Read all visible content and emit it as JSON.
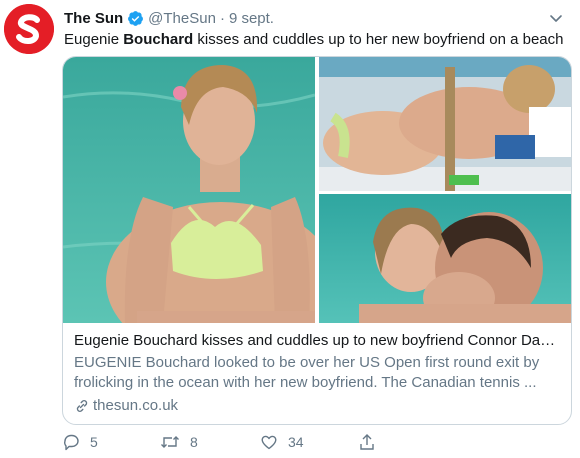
{
  "tweet": {
    "author_name": "The Sun",
    "handle": "@TheSun",
    "separator": "·",
    "timestamp": "9 sept.",
    "text_before": "Eugenie ",
    "text_bold": "Bouchard",
    "text_after": " kisses and cuddles up to her new boyfriend on a beach",
    "verified": true
  },
  "card": {
    "title": "Eugenie Bouchard kisses and cuddles up to new boyfriend Connor Davi...",
    "description_line1": "EUGENIE Bouchard looked to be over her US Open first round exit by",
    "description_line2": "frolicking in the ocean with her new boyfriend. The Canadian tennis ...",
    "domain": "thesun.co.uk"
  },
  "actions": {
    "replies": "5",
    "retweets": "8",
    "likes": "34"
  },
  "colors": {
    "brand_red": "#e41e26",
    "verified_blue": "#1da1f2",
    "muted_text": "#657786",
    "border": "#ccd6dd",
    "sea": "#4fb8a8"
  },
  "icons": {
    "avatar": "the-sun-logo",
    "verified": "verified-badge-icon",
    "more": "chevron-down-icon",
    "link": "link-icon",
    "reply": "reply-icon",
    "retweet": "retweet-icon",
    "like": "heart-icon",
    "share": "share-icon"
  }
}
